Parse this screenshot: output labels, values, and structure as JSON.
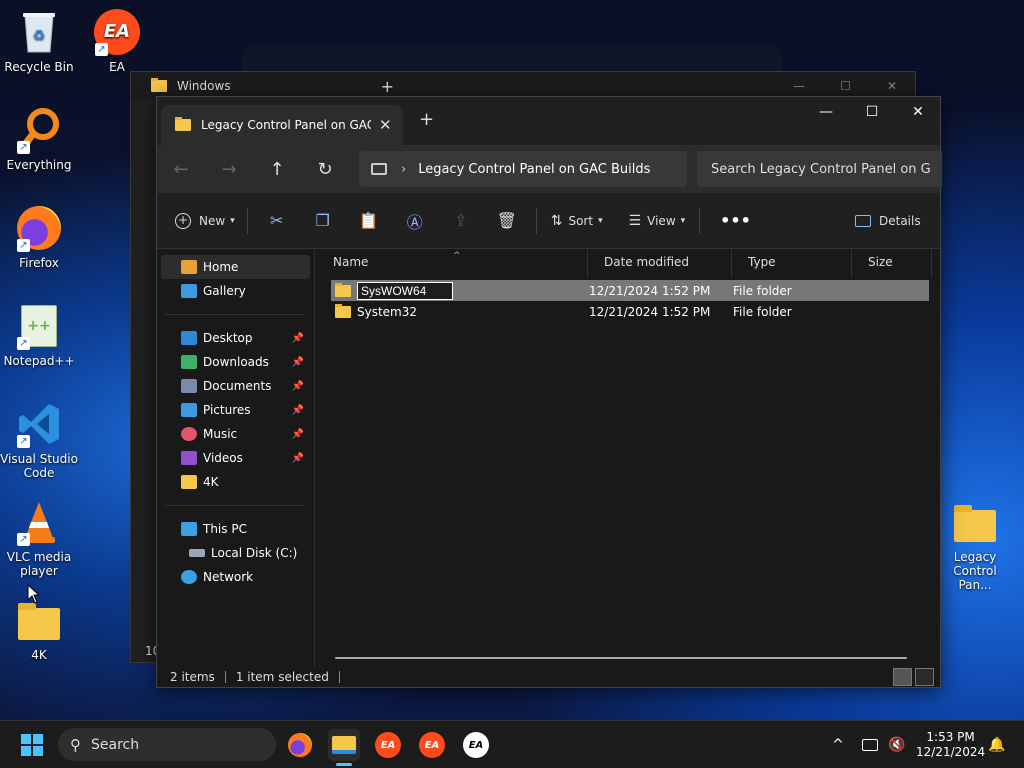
{
  "desktop": {
    "icons": [
      {
        "label": "Recycle Bin"
      },
      {
        "label": "EA"
      },
      {
        "label": "Everything"
      },
      {
        "label": "Firefox"
      },
      {
        "label": "Notepad++"
      },
      {
        "label": "Visual Studio Code"
      },
      {
        "label": "VLC media player"
      },
      {
        "label": "4K"
      },
      {
        "label": "Legacy Control Pan..."
      }
    ]
  },
  "background_window": {
    "title": "Windows",
    "status": "10"
  },
  "explorer": {
    "tab_title": "Legacy Control Panel on GAC Builds",
    "tab_title_visible": "Legacy Control Panel on GAC I",
    "breadcrumb": "Legacy Control Panel on GAC Builds",
    "search_placeholder": "Search Legacy Control Panel on G",
    "toolbar": {
      "new": "New",
      "sort": "Sort",
      "view": "View",
      "details": "Details"
    },
    "nav": {
      "home": "Home",
      "gallery": "Gallery",
      "quick": [
        {
          "label": "Desktop",
          "color": "#2e8ad8"
        },
        {
          "label": "Downloads",
          "color": "#3fb06a"
        },
        {
          "label": "Documents",
          "color": "#7a8aa8"
        },
        {
          "label": "Pictures",
          "color": "#3a9be0"
        },
        {
          "label": "Music",
          "color": "#e0566b"
        },
        {
          "label": "Videos",
          "color": "#8e4fd0"
        },
        {
          "label": "4K",
          "color": "#f5c84b"
        }
      ],
      "this_pc": "This PC",
      "local_disk": "Local Disk (C:)",
      "network": "Network"
    },
    "columns": {
      "name": "Name",
      "date": "Date modified",
      "type": "Type",
      "size": "Size"
    },
    "rows": [
      {
        "name": "SysWOW64",
        "date": "12/21/2024 1:52 PM",
        "type": "File folder",
        "selected": true,
        "renaming": true
      },
      {
        "name": "System32",
        "date": "12/21/2024 1:52 PM",
        "type": "File folder",
        "selected": false
      }
    ],
    "status": {
      "items": "2 items",
      "selected": "1 item selected"
    }
  },
  "taskbar": {
    "search": "Search",
    "time": "1:53 PM",
    "date": "12/21/2024"
  },
  "colors": {
    "accent": "#8cb8ff",
    "folder": "#f5c84b",
    "ea": "#ff4a1c"
  }
}
